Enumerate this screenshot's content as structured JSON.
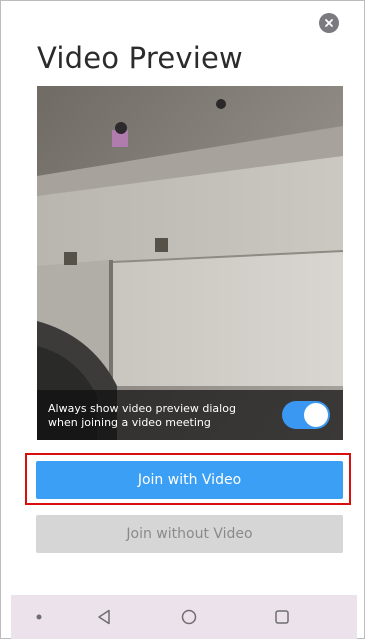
{
  "dialog": {
    "title": "Video Preview",
    "close_icon": "close-icon",
    "preview": {
      "toggle_label": "Always show video preview dialog\nwhen joining a video meeting",
      "toggle_on": true
    },
    "join_with_video_label": "Join with Video",
    "join_without_video_label": "Join without Video"
  },
  "navbar": {
    "items": [
      "dot-icon",
      "back-icon",
      "home-icon",
      "recents-icon"
    ]
  },
  "colors": {
    "primary": "#3ba0f5",
    "toggle_on": "#3a98f2",
    "highlight": "#d80f0f",
    "secondary_button": "#d6d6d6",
    "navbar": "#ece2ec"
  }
}
